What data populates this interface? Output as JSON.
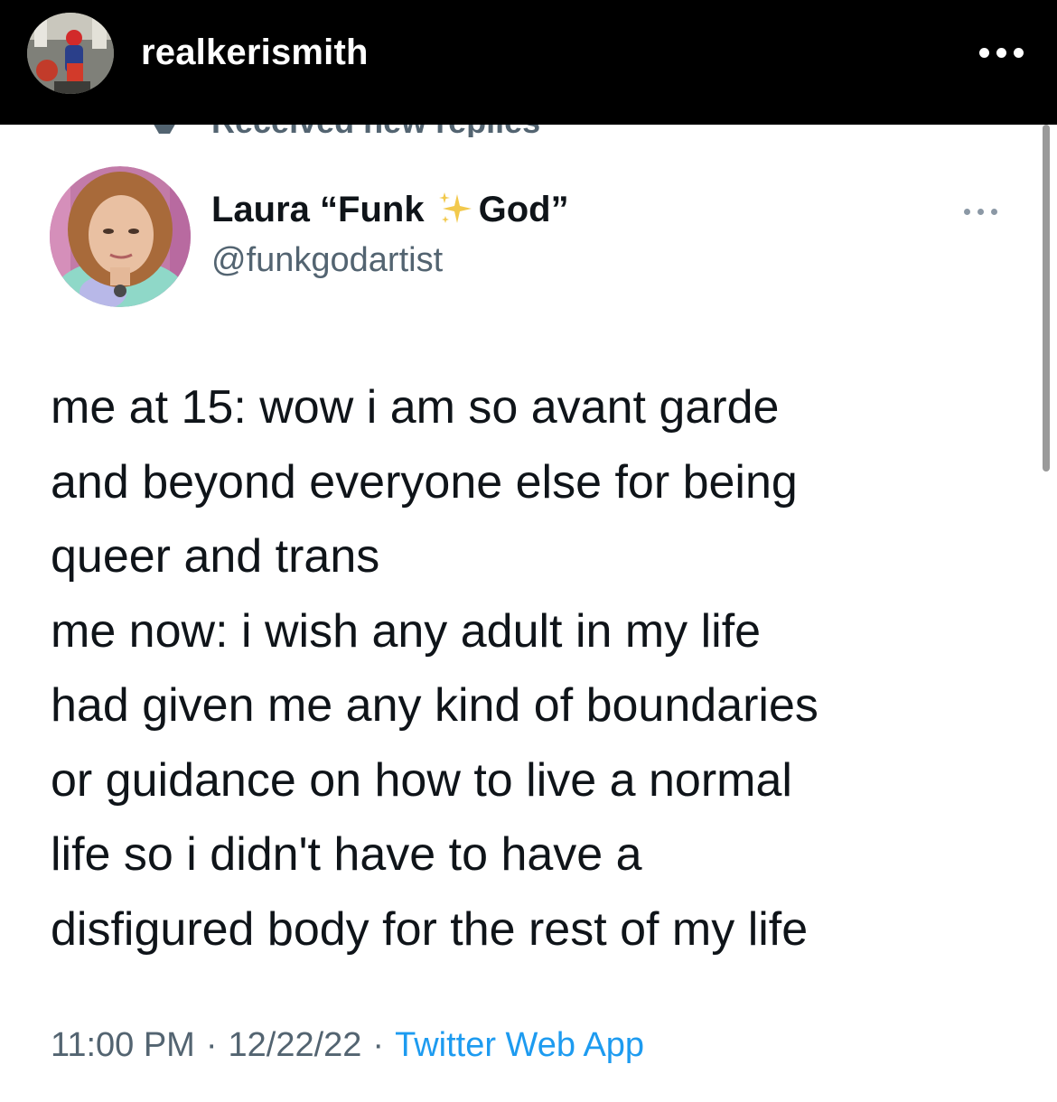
{
  "instagram": {
    "username": "realkerismith",
    "avatar_icon": "user-avatar-photo",
    "more_icon": "more-horizontal-icon"
  },
  "cropped_notice": {
    "text": "Received new replies",
    "icon": "arrow-icon"
  },
  "tweet": {
    "author_name_part1": "Laura “Funk",
    "author_sparkle_icon": "sparkles-emoji",
    "author_name_part2": "God”",
    "handle": "@funkgodartist",
    "more_icon": "more-horizontal-icon",
    "text_lines": [
      "me at 15: wow i am so avant garde",
      "and beyond everyone else for being",
      "queer and trans",
      "me now: i wish any adult in my life",
      "had given me any kind of boundaries",
      "or guidance on how to live a normal",
      "life so i didn't have to have a",
      "disfigured body for the rest of my life"
    ],
    "time": "11:00 PM",
    "separator": "·",
    "date": "12/22/22",
    "source_app": "Twitter Web App"
  },
  "colors": {
    "header_bg": "#000000",
    "text_primary": "#0f1419",
    "text_secondary": "#536471",
    "link_blue": "#1d9bf0"
  }
}
